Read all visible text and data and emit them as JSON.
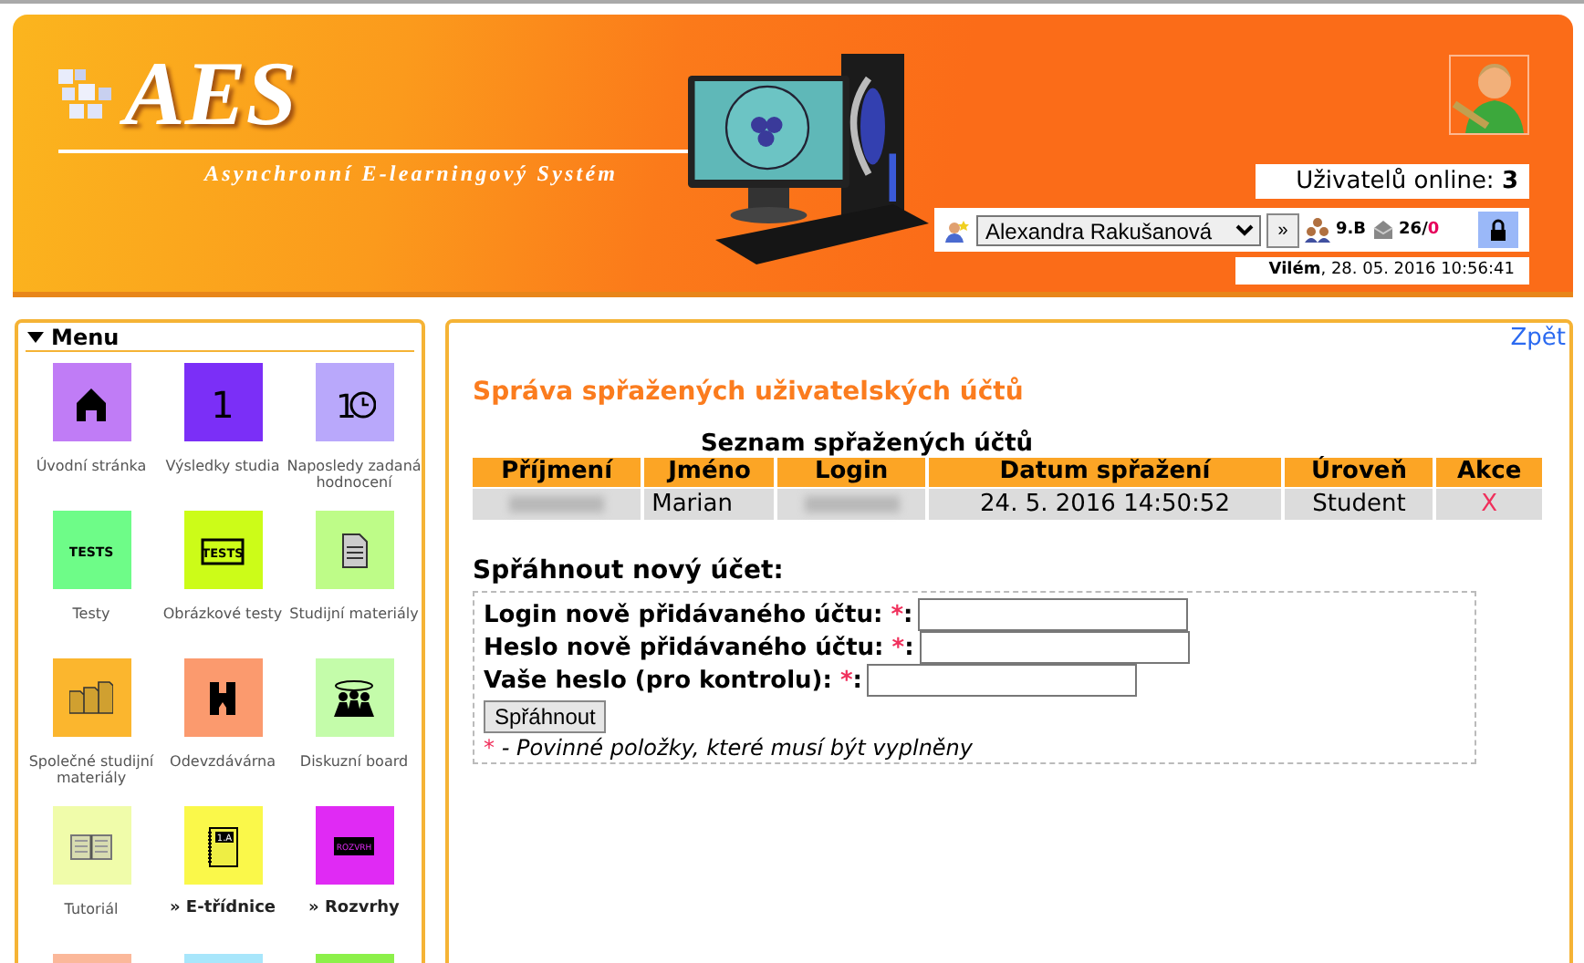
{
  "header": {
    "logo": "AES",
    "subtitle": "Asynchronní E-learningový Systém",
    "online": {
      "label": "Uživatelů online:",
      "count": "3"
    },
    "toolbar": {
      "user": "Alexandra Rakušanová",
      "go": "»",
      "class_name": "9.B",
      "messages": "26/",
      "unread": "0"
    },
    "date": "**Vilém**, 28. 05. 2016 10:56:41"
  },
  "menu": {
    "title": "Menu",
    "expanded": true,
    "items": [
      {
        "kind": "home",
        "label": "Úvodní stránka",
        "color": "#c07cf6",
        "bold": false
      },
      {
        "kind": "number",
        "icon_text": "1",
        "label": "Výsledky studia",
        "color": "#7b2ff7",
        "bold": false
      },
      {
        "kind": "clock",
        "icon_text": "1",
        "label": "Naposledy zadaná hodnocení",
        "color": "#b9a8fb",
        "bold": false
      },
      {
        "kind": "tests",
        "icon_text": "TESTS",
        "label": "Testy",
        "color": "#6efc88",
        "bold": false
      },
      {
        "kind": "tests-framed",
        "icon_text": "TESTS",
        "label": "Obrázkové testy",
        "color": "#ccfc18",
        "bold": false
      },
      {
        "kind": "document",
        "label": "Studijní materiály",
        "color": "#befc88",
        "bold": false
      },
      {
        "kind": "documents",
        "label": "Společné studijní materiály",
        "color": "#fbb62e",
        "bold": false
      },
      {
        "kind": "hand-in",
        "label": "Odevzdávárna",
        "color": "#fb9a6e",
        "bold": false
      },
      {
        "kind": "people",
        "label": "Diskuzní board",
        "color": "#c4fcaa",
        "bold": false
      },
      {
        "kind": "book",
        "label": "Tutoriál",
        "color": "#f0fcaa",
        "bold": false
      },
      {
        "kind": "notebook",
        "icon_text": "1.A",
        "label": "» E-třídnice",
        "color": "#faf84a",
        "bold": true
      },
      {
        "kind": "schedule",
        "icon_text": "ROZVRH",
        "label": "» Rozvrhy",
        "color": "#e02af4",
        "bold": true
      },
      {
        "kind": "blank",
        "color": "#fbb89a"
      },
      {
        "kind": "blank",
        "color": "#a8e6fb"
      },
      {
        "kind": "blank",
        "color": "#8cf04a"
      }
    ]
  },
  "main": {
    "back_link": "Zpět",
    "title": "Správa spřažených uživatelských účtů",
    "table": {
      "caption": "Seznam spřažených účtů",
      "columns": [
        "Příjmení",
        "Jméno",
        "Login",
        "Datum spřažení",
        "Úroveň",
        "Akce"
      ],
      "rows": [
        [
          {
            "kind": "redacted"
          },
          {
            "kind": "text",
            "text": "Marian"
          },
          {
            "kind": "redacted"
          },
          {
            "kind": "text",
            "text": "24. 5. 2016 14:50:52"
          },
          {
            "kind": "text",
            "text": "Student"
          },
          {
            "kind": "action",
            "text": "X"
          }
        ]
      ]
    },
    "form": {
      "title": "Spřáhnout nový účet:",
      "fields": [
        {
          "label": "Login nově přidávaného účtu:",
          "required_mark": "*",
          "suffix": ":"
        },
        {
          "label": "Heslo nově přidávaného účtu:",
          "required_mark": "*",
          "suffix": ":"
        },
        {
          "label": "Vaše heslo (pro kontrolu):",
          "required_mark": "*",
          "suffix": ":"
        }
      ],
      "submit": "Spřáhnout",
      "note_mark": "*",
      "note": "- Povinné položky, které musí být vyplněny"
    }
  }
}
